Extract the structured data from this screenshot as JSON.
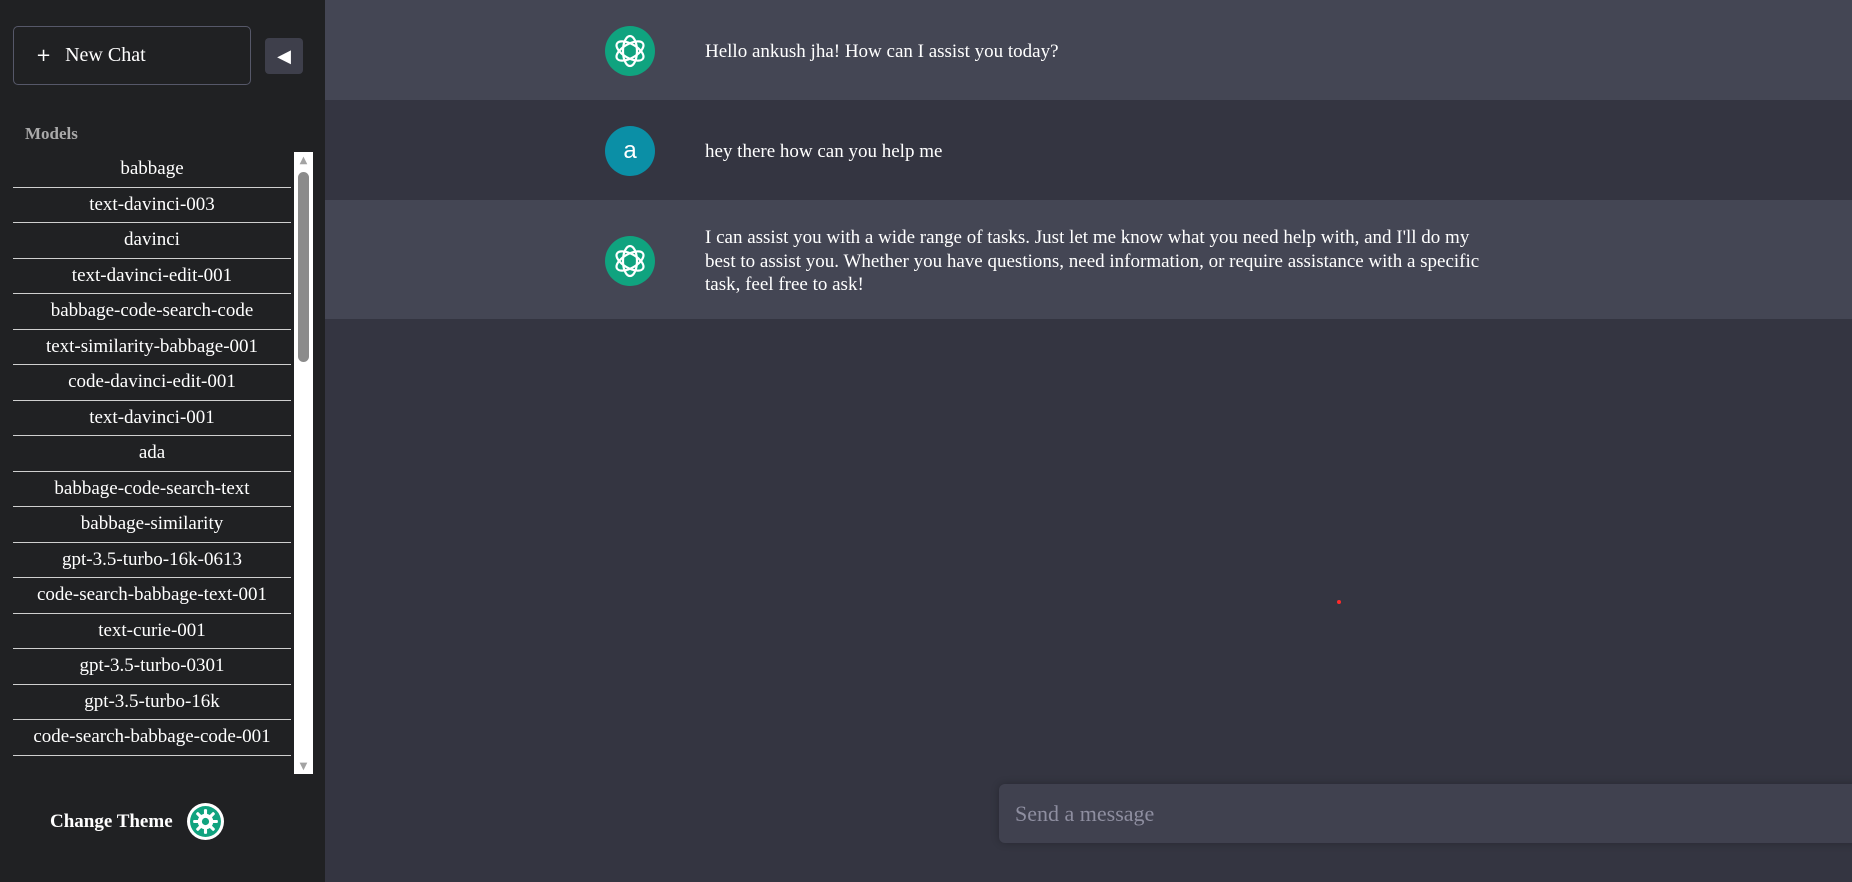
{
  "sidebar": {
    "new_chat_label": "New Chat",
    "new_chat_icon": "plus-icon",
    "collapse_icon": "triangle-left-icon",
    "models_heading": "Models",
    "models": [
      "babbage",
      "text-davinci-003",
      "davinci",
      "text-davinci-edit-001",
      "babbage-code-search-code",
      "text-similarity-babbage-001",
      "code-davinci-edit-001",
      "text-davinci-001",
      "ada",
      "babbage-code-search-text",
      "babbage-similarity",
      "gpt-3.5-turbo-16k-0613",
      "code-search-babbage-text-001",
      "text-curie-001",
      "gpt-3.5-turbo-0301",
      "gpt-3.5-turbo-16k",
      "code-search-babbage-code-001"
    ],
    "change_theme_label": "Change Theme",
    "theme_icon": "gear-icon"
  },
  "chat": {
    "messages": [
      {
        "role": "assistant",
        "text": "Hello ankush jha! How can I assist you today?"
      },
      {
        "role": "user",
        "avatar_letter": "a",
        "text": "hey there how can you help me"
      },
      {
        "role": "assistant",
        "text": "I can assist you with a wide range of tasks. Just let me know what you need help with, and I'll do my best to assist you. Whether you have questions, need information, or require assistance with a specific task, feel free to ask!"
      }
    ],
    "input_placeholder": "Send a message"
  },
  "colors": {
    "sidebar_bg": "#202123",
    "main_bg": "#343541",
    "assistant_row_bg": "#444654",
    "bot_avatar": "#10a37f",
    "user_avatar": "#0b8fa6",
    "input_bg": "#40414f"
  }
}
